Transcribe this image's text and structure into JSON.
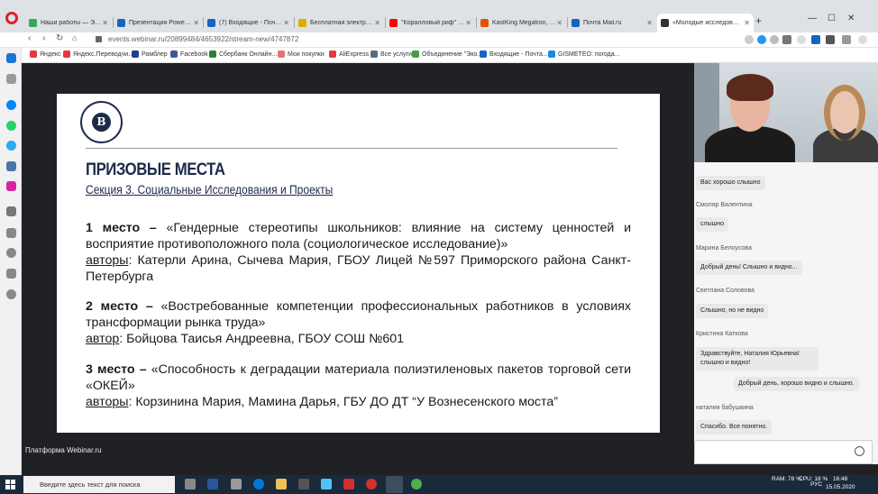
{
  "browser": {
    "tabs": [
      {
        "title": "Наши работы — Эколо...",
        "color": "#3aa757"
      },
      {
        "title": "Презентация PowerPoint",
        "color": "#1565c0"
      },
      {
        "title": "(7) Входящие - Почта Ma...",
        "color": "#1565c0"
      },
      {
        "title": "Бесплатная электронная...",
        "color": "#e0a800"
      },
      {
        "title": "\"Коралловый риф\" зверо...",
        "color": "#ff0000"
      },
      {
        "title": "KastKing Megatron, 21 кг...",
        "color": "#e65100"
      },
      {
        "title": "Почта Mail.ru",
        "color": "#1565c0"
      },
      {
        "title": "«Молодые исследовате...",
        "color": "#333333"
      }
    ],
    "url": "events.webinar.ru/20899484/4653922/stream-new/4747872",
    "bookmarks": [
      {
        "label": "Яндекс",
        "color": "#e53935"
      },
      {
        "label": "Яндекс.Переводчи...",
        "color": "#e53935"
      },
      {
        "label": "Рамблер",
        "color": "#1e3f8c"
      },
      {
        "label": "Facebook",
        "color": "#3b5998"
      },
      {
        "label": "Сбербанк Онлайн...",
        "color": "#2e7d32"
      },
      {
        "label": "Мои покупки",
        "color": "#e57373"
      },
      {
        "label": "AliExpress",
        "color": "#e53935"
      },
      {
        "label": "Все услуги",
        "color": "#546e7a"
      },
      {
        "label": "Объединение \"Эко...",
        "color": "#43a047"
      },
      {
        "label": "Входящие - Почта...",
        "color": "#1565c0"
      },
      {
        "label": "GISMETEO: погода...",
        "color": "#1e88e5"
      }
    ]
  },
  "slide": {
    "title": "ПРИЗОВЫЕ МЕСТА",
    "subtitle": "Секция 3. Социальные Исследования и Проекты",
    "places": [
      {
        "place": "1 место – ",
        "work": "«Гендерные стереотипы школьников: влияние на систему ценностей и восприятие противоположного пола (социологическое исследование)»",
        "label": "авторы",
        "authors": ": Катерли Арина, Сычева Мария, ГБОУ Лицей №597 Приморского района Санкт-Петербурга"
      },
      {
        "place": "2 место – ",
        "work": "«Востребованные компетенции профессиональных работников в условиях трансформации рынка труда»",
        "label": "автор",
        "authors": ": Бойцова Таисья Андреевна, ГБОУ СОШ №601"
      },
      {
        "place": "3 место – ",
        "work": "«Способность к деградации материала полиэтиленовых пакетов торговой сети «ОКЕЙ»",
        "label": "авторы",
        "authors": ": Корзинина Мария, Мамина Дарья, ГБУ ДО ДТ “У Вознесенского моста”"
      }
    ]
  },
  "platform_label": "Платформа Webinar.ru",
  "chat": {
    "messages": [
      {
        "author": "",
        "text": "Вас хорошо слышно"
      },
      {
        "author": "Смоляр Валентина",
        "text": "слышно"
      },
      {
        "author": "Марина Белоусова",
        "text": "Добрый день! Слышно и видно..."
      },
      {
        "author": "Светлана Соловова",
        "text": "Слышно, но не видно"
      },
      {
        "author": "Кристина Каткова",
        "text": "Здравствуйте, Наталия Юрьевна! слышно и видно!"
      },
      {
        "author": "",
        "text": "Добрый день, хорошо видно и слышно."
      },
      {
        "author": "наталия бабушкина",
        "text": "Спасибо. Все понятно."
      }
    ]
  },
  "taskbar": {
    "search_placeholder": "Введите здесь текст для поиска",
    "ram": "RAM: 78 %",
    "cpu": "CPU: 18 %",
    "lang": "РУС",
    "time": "16:48",
    "date": "15.05.2020"
  }
}
